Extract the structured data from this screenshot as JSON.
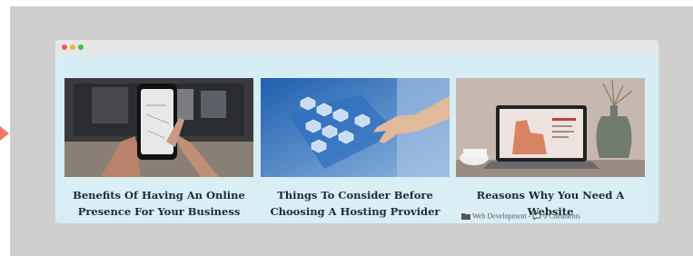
{
  "window": {
    "controls": [
      "close",
      "minimize",
      "maximize"
    ]
  },
  "colors": {
    "backdrop": "#cfcfcf",
    "browser_bg": "#d7edf4",
    "title_text": "#1f2a35",
    "accent_mark": "#f07a6a"
  },
  "posts": [
    {
      "title_line1": "Benefits Of Having An Online",
      "title_line2": "Presence For Your Business",
      "image": "hands-holding-smartphone-photo"
    },
    {
      "title_line1": "Things To Consider Before",
      "title_line2": "Choosing A Hosting Provider",
      "image": "hand-touching-hexagon-network-photo"
    },
    {
      "title_line1": "Reasons Why You Need A Website",
      "image": "laptop-on-desk-photo",
      "category": "Web Development",
      "separator": "-",
      "comments": "0 Comments",
      "category_icon": "folder-icon",
      "comments_icon": "comment-icon"
    }
  ]
}
